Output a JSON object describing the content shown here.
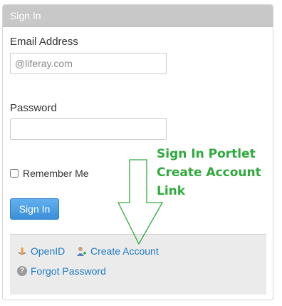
{
  "portlet": {
    "title": "Sign In",
    "email_label": "Email Address",
    "email_placeholder": "@liferay.com",
    "password_label": "Password",
    "remember_label": "Remember Me",
    "sign_in_button": "Sign In"
  },
  "navigation": {
    "openid": "OpenID",
    "create_account": "Create Account",
    "forgot_password": "Forgot Password"
  },
  "annotation": {
    "text": "Sign In Portlet\nCreate Account\nLink",
    "color": "#2eaa3c"
  },
  "colors": {
    "header_bg": "#c8c8c8",
    "button_bg": "#3b8fd8",
    "link": "#1f7bc4"
  },
  "icons": {
    "openid": "openid-icon",
    "create_account": "user-add-icon",
    "forgot_password": "question-bubble-icon"
  }
}
